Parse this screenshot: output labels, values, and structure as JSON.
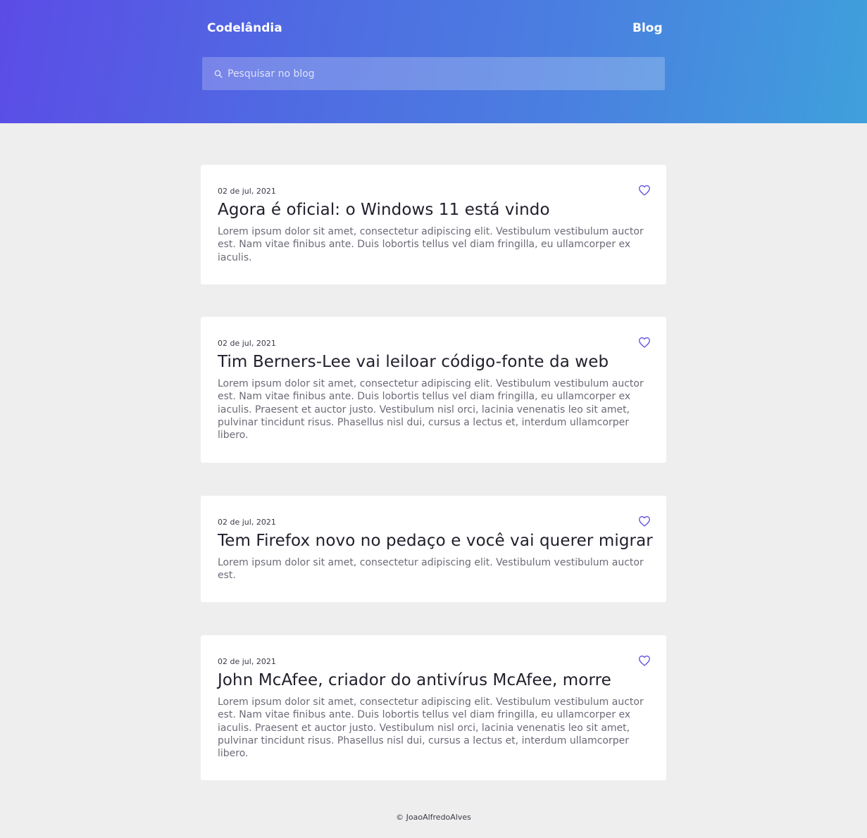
{
  "header": {
    "brand": "Codelândia",
    "nav_blog": "Blog",
    "search_placeholder": "Pesquisar no blog"
  },
  "posts": [
    {
      "date": "02 de jul, 2021",
      "title": "Agora é oficial: o Windows 11 está vindo",
      "excerpt": "Lorem ipsum dolor sit amet, consectetur adipiscing elit. Vestibulum vestibulum auctor est. Nam vitae finibus ante. Duis lobortis tellus vel diam fringilla, eu ullamcorper ex iaculis."
    },
    {
      "date": "02 de jul, 2021",
      "title": "Tim Berners-Lee vai leiloar código-fonte da web",
      "excerpt": "Lorem ipsum dolor sit amet, consectetur adipiscing elit. Vestibulum vestibulum auctor est. Nam vitae finibus ante. Duis lobortis tellus vel diam fringilla, eu ullamcorper ex iaculis. Praesent et auctor justo. Vestibulum nisl orci, lacinia venenatis leo sit amet, pulvinar tincidunt risus. Phasellus nisl dui, cursus a lectus et, interdum ullamcorper libero."
    },
    {
      "date": "02 de jul, 2021",
      "title": "Tem Firefox novo no pedaço e você vai querer migrar",
      "excerpt": "Lorem ipsum dolor sit amet, consectetur adipiscing elit. Vestibulum vestibulum auctor est."
    },
    {
      "date": "02 de jul, 2021",
      "title": "John McAfee, criador do antivírus McAfee, morre",
      "excerpt": "Lorem ipsum dolor sit amet, consectetur adipiscing elit. Vestibulum vestibulum auctor est. Nam vitae finibus ante. Duis lobortis tellus vel diam fringilla, eu ullamcorper ex iaculis. Praesent et auctor justo. Vestibulum nisl orci, lacinia venenatis leo sit amet, pulvinar tincidunt risus. Phasellus nisl dui, cursus a lectus et, interdum ullamcorper libero."
    }
  ],
  "footer": {
    "copyright": "© JoaoAlfredoAlves"
  },
  "icons": {
    "search": "search-icon",
    "heart": "heart-icon"
  },
  "colors": {
    "gradient_start": "#5b4ce6",
    "gradient_end": "#3fa0dc",
    "heart": "#6a5ce0",
    "background": "#eeeeee"
  }
}
